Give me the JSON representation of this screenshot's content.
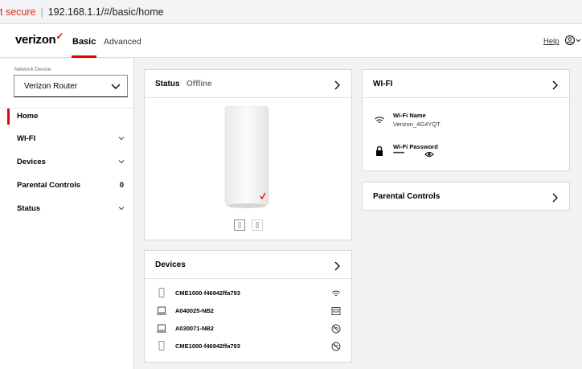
{
  "browser": {
    "security_label": "t secure",
    "url": "192.168.1.1/#/basic/home"
  },
  "header": {
    "logo": "verizon",
    "logo_check": "✓",
    "tabs": [
      {
        "label": "Basic",
        "active": true
      },
      {
        "label": "Advanced",
        "active": false
      }
    ],
    "help_label": "Help",
    "user_menu_icon": "user-circle-icon"
  },
  "sidebar": {
    "network_device_label": "Network Device",
    "network_device_value": "Verizon Router",
    "items": [
      {
        "label": "Home",
        "active": true
      },
      {
        "label": "WI-FI",
        "expandable": true
      },
      {
        "label": "Devices",
        "expandable": true
      },
      {
        "label": "Parental Controls",
        "badge": "0"
      },
      {
        "label": "Status",
        "expandable": true
      }
    ]
  },
  "status_card": {
    "title": "Status",
    "state": "Offline"
  },
  "wifi_card": {
    "title": "WI-FI",
    "name_label": "Wi-Fi Name",
    "name_value": "Verizon_4G4YQT",
    "password_label": "Wi-Fi Password",
    "password_value": "••••••••••••"
  },
  "parental_card": {
    "title": "Parental Controls"
  },
  "devices_card": {
    "title": "Devices",
    "rows": [
      {
        "name": "CME1000-f46942ffa793",
        "device_icon": "phone-icon",
        "status_icon": "wifi-icon"
      },
      {
        "name": "A040025-NB2",
        "device_icon": "laptop-icon",
        "status_icon": "ethernet-icon"
      },
      {
        "name": "A030071-NB2",
        "device_icon": "laptop-icon",
        "status_icon": "wifi-off-icon"
      },
      {
        "name": "CME1000-f46942ffa793",
        "device_icon": "phone-icon",
        "status_icon": "wifi-off-icon"
      }
    ]
  },
  "colors": {
    "brand_red": "#ee0000",
    "background": "#f2f2f2",
    "card": "#ffffff"
  }
}
